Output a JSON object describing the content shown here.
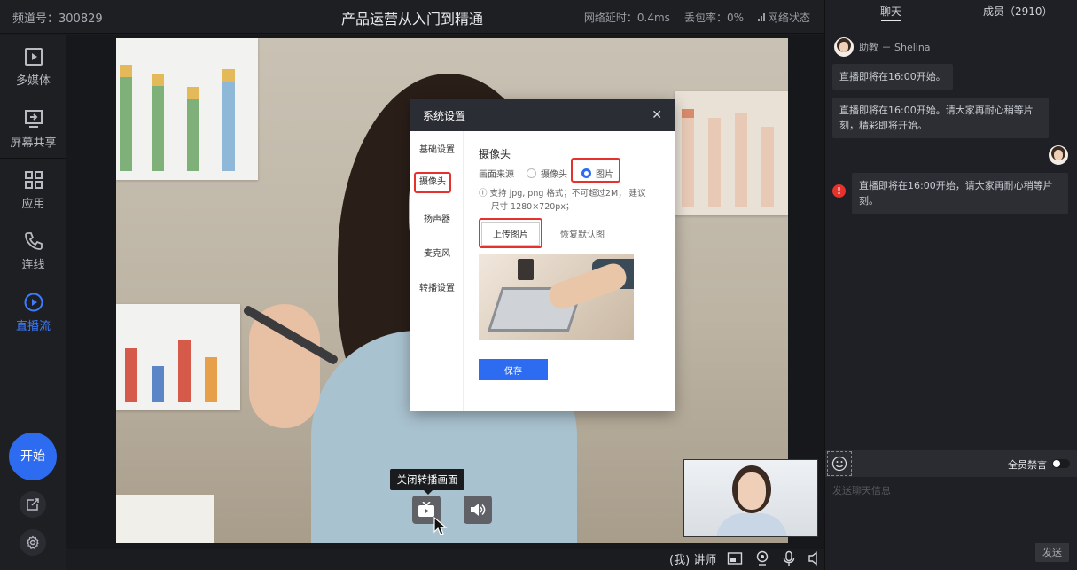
{
  "header": {
    "channel": "频道号：300829",
    "title": "产品运营从入门到精通",
    "latency": "网络延时：0.4ms",
    "loss": "丢包率：0%",
    "net_status": "网络状态"
  },
  "sidebar": {
    "items": [
      {
        "label": "多媒体",
        "icon": "media-icon"
      },
      {
        "label": "屏幕共享",
        "icon": "screen-share-icon"
      },
      {
        "label": "应用",
        "icon": "apps-icon"
      },
      {
        "label": "连线",
        "icon": "phone-icon"
      },
      {
        "label": "直播流",
        "icon": "live-stream-icon"
      }
    ],
    "start_label": "开始"
  },
  "dialog": {
    "title": "系统设置",
    "nav": [
      "基础设置",
      "摄像头",
      "扬声器",
      "麦克风",
      "转播设置"
    ],
    "section_title": "摄像头",
    "source_label": "画面来源",
    "option_camera": "摄像头",
    "option_image": "图片",
    "info_line1": "支持 jpg, png 格式；不可超过2M； 建议",
    "info_line2": "尺寸 1280×720px；",
    "upload_label": "上传图片",
    "restore_label": "恢复默认图",
    "save_label": "保存"
  },
  "player": {
    "tooltip": "关闭转播画面",
    "role": "(我) 讲师"
  },
  "chat": {
    "tab_chat": "聊天",
    "tab_members": "成员（2910）",
    "sender": "助教 － Shelina",
    "messages": [
      "直播即将在16:00开始。",
      "直播即将在16:00开始。请大家再耐心稍等片刻，精彩即将开始。",
      "直播即将在16:00开始，请大家再耐心稍等片刻。"
    ],
    "mute_all": "全员禁言",
    "input_placeholder": "发送聊天信息",
    "send_label": "发送"
  },
  "colors": {
    "accent": "#2d6cf0",
    "highlight": "#e5322d",
    "error": "#e5322d"
  }
}
